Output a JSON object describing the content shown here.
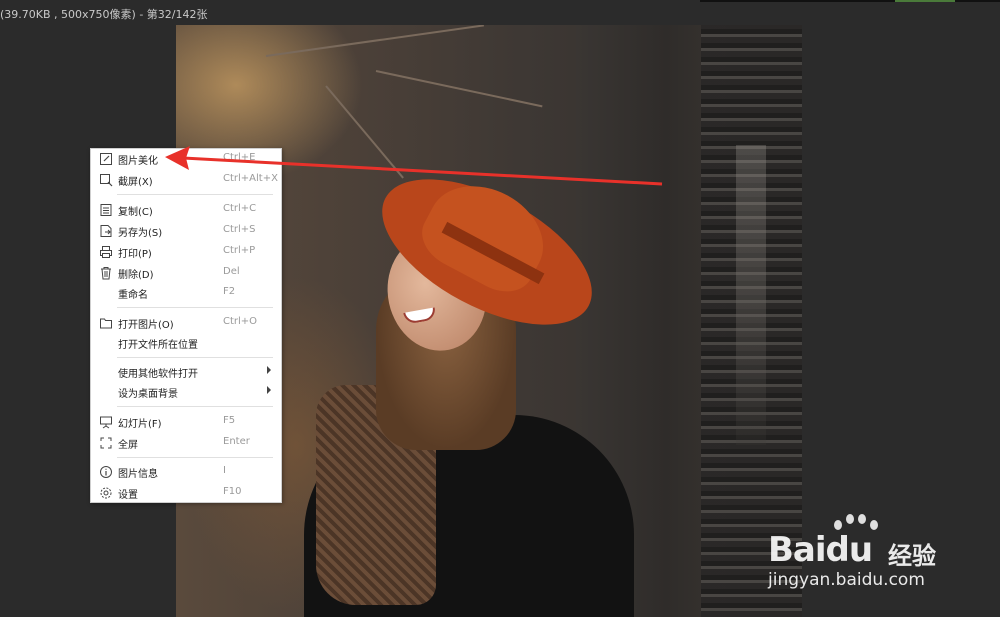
{
  "window": {
    "title": "(39.70KB , 500x750像素) - 第32/142张"
  },
  "menu": {
    "items": [
      {
        "label": "图片美化",
        "shortcut": "Ctrl+E",
        "icon": "edit-icon"
      },
      {
        "label": "截屏(X)",
        "shortcut": "Ctrl+Alt+X",
        "icon": "screenshot-icon"
      },
      {
        "label": "复制(C)",
        "shortcut": "Ctrl+C",
        "icon": "copy-icon"
      },
      {
        "label": "另存为(S)",
        "shortcut": "Ctrl+S",
        "icon": "save-as-icon"
      },
      {
        "label": "打印(P)",
        "shortcut": "Ctrl+P",
        "icon": "print-icon"
      },
      {
        "label": "删除(D)",
        "shortcut": "Del",
        "icon": "delete-icon"
      },
      {
        "label": "重命名",
        "shortcut": "F2",
        "icon": ""
      },
      {
        "label": "打开图片(O)",
        "shortcut": "Ctrl+O",
        "icon": "folder-icon"
      },
      {
        "label": "打开文件所在位置",
        "shortcut": "",
        "icon": ""
      },
      {
        "label": "使用其他软件打开",
        "shortcut": "",
        "icon": "",
        "submenu": true
      },
      {
        "label": "设为桌面背景",
        "shortcut": "",
        "icon": "",
        "submenu": true
      },
      {
        "label": "幻灯片(F)",
        "shortcut": "F5",
        "icon": "slideshow-icon"
      },
      {
        "label": "全屏",
        "shortcut": "Enter",
        "icon": "fullscreen-icon"
      },
      {
        "label": "图片信息",
        "shortcut": "I",
        "icon": "info-icon"
      },
      {
        "label": "设置",
        "shortcut": "F10",
        "icon": "gear-icon"
      }
    ]
  },
  "annotation": {
    "color": "#e8312a"
  },
  "watermark": {
    "brand": "Bai",
    "brand_suffix": "du",
    "product": "经验",
    "url": "jingyan.baidu.com"
  }
}
